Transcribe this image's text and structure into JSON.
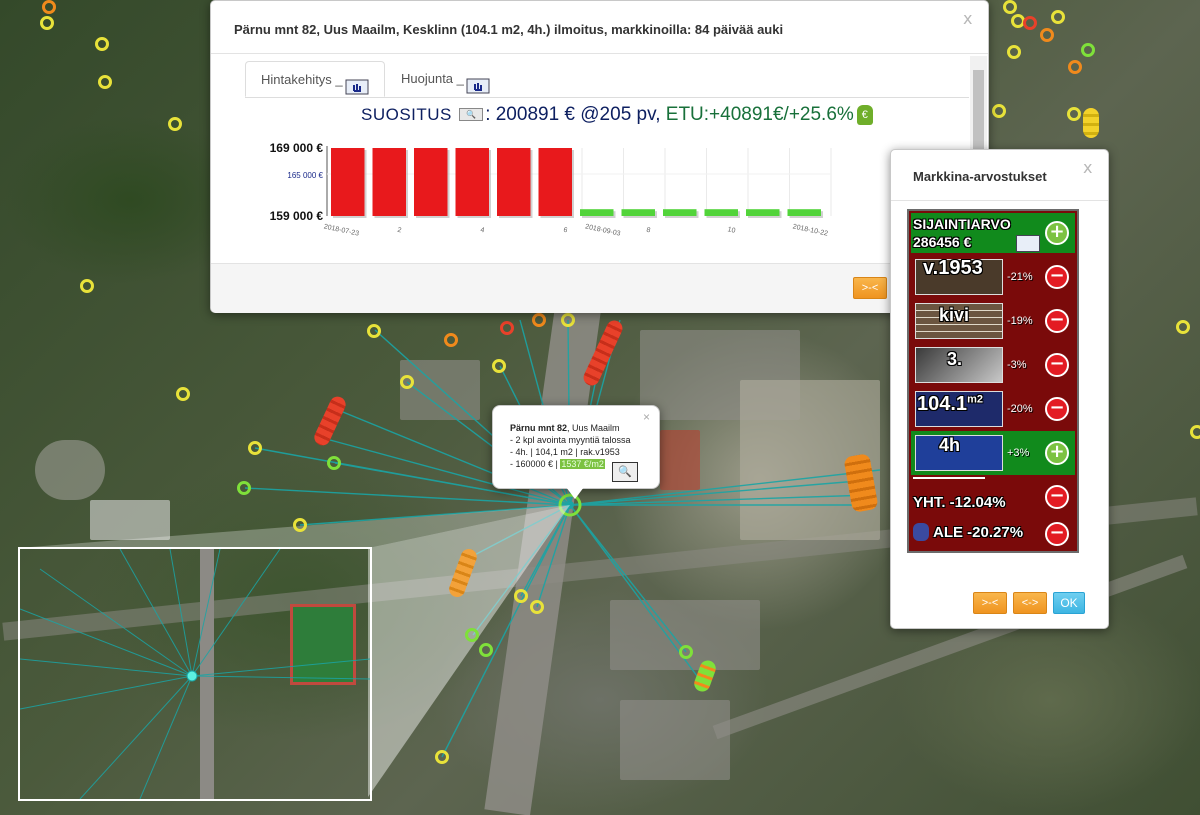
{
  "dialog": {
    "title": "Pärnu mnt 82, Uus Maailm, Kesklinn (104.1 m2, 4h.) ilmoitus, markkinoilla: 84 päivää auki",
    "close": "x",
    "tabs": [
      {
        "label": "Hintakehitys _"
      },
      {
        "label": "Huojunta _"
      }
    ],
    "recommendation": {
      "label": "SUOSITUS",
      "value": ": 200891 € @205 pv",
      "sep": ",",
      "advantage": "ETU:+40891€/+25.6%"
    },
    "nav_button": ">-<"
  },
  "chart_data": {
    "type": "bar",
    "title": "",
    "y_tick_labels": [
      "169 000 €",
      "165 000 €",
      "159 000 €"
    ],
    "x_tick_labels": [
      "2018-07-23",
      "2",
      "4",
      "6",
      "2018-09-03",
      "8",
      "10",
      "2018-10-22"
    ],
    "ylim": [
      159000,
      169000
    ],
    "series": [
      {
        "color": "#e8191c",
        "values": [
          169000,
          169000,
          169000,
          169000,
          169000,
          169000
        ]
      },
      {
        "color": "#52d43a",
        "values": [
          160000,
          160000,
          160000,
          160000,
          160000,
          160000
        ]
      }
    ]
  },
  "valuation": {
    "title": "Markkina-arvostukset",
    "close": "x",
    "location_label": "SIJAINTIARVO",
    "location_value": "286456 €",
    "rows": [
      {
        "label": "v.1953",
        "pct": "-21%",
        "sign": "−"
      },
      {
        "label": "kivi",
        "pct": "-19%",
        "sign": "−"
      },
      {
        "label": "3.",
        "pct": "-3%",
        "sign": "−"
      },
      {
        "label": "104.1",
        "sup": "m2",
        "pct": "-20%",
        "sign": "−"
      },
      {
        "label": "4h",
        "pct": "+3%",
        "sign": "+"
      }
    ],
    "total": "YHT. -12.04%",
    "discount": "ALE -20.27%",
    "plus": "+",
    "minus": "−",
    "buttons": {
      "prev": ">-<",
      "swap": "<->",
      "ok": "OK"
    }
  },
  "info_popup": {
    "address": "Pärnu mnt 82",
    "district": ", Uus Maailm",
    "line1": "- 2 kpl avointa myyntiä talossa",
    "line2": "- 4h. | 104,1 m2 | rak.v1953",
    "price": "- 160000 € |",
    "price_m2": "1537 €/m2",
    "close": "×"
  },
  "colors": {
    "recommendation_text": "#0d1f60",
    "advantage_text": "#18703a",
    "valuation_bg": "#7a0a0a",
    "positive": "#7cc242",
    "negative": "#e31b23"
  }
}
